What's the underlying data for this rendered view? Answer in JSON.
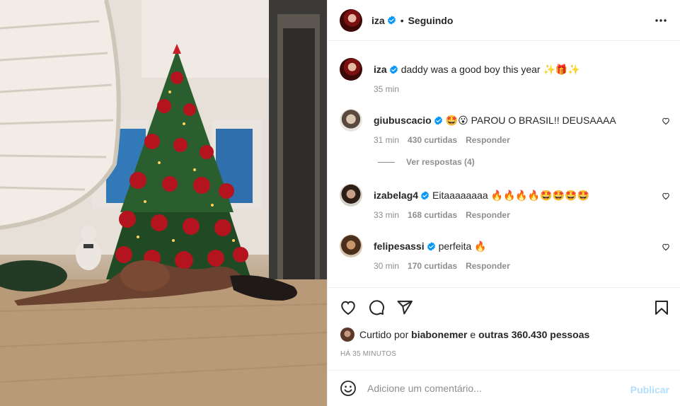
{
  "post": {
    "author": "iza",
    "follow_status": "Seguindo",
    "separator": "•",
    "caption": {
      "username": "iza",
      "text": "daddy was a good boy this year ✨🎁✨",
      "time": "35 min"
    },
    "comments": [
      {
        "username": "giubuscacio",
        "text": "🤩😮 PAROU O BRASIL!! DEUSAAAA",
        "time": "31 min",
        "likes": "430 curtidas",
        "reply_label": "Responder"
      },
      {
        "username": "izabelag4",
        "text": "Eitaaaaaaaa 🔥🔥🔥🔥🤩🤩🤩🤩",
        "time": "33 min",
        "likes": "168 curtidas",
        "reply_label": "Responder"
      },
      {
        "username": "felipesassi",
        "text": "perfeita 🔥",
        "time": "30 min",
        "likes": "170 curtidas",
        "reply_label": "Responder"
      }
    ],
    "view_replies": "Ver respostas (4)",
    "liked_by": {
      "prefix": "Curtido por",
      "user": "biabonemer",
      "connector": "e",
      "others": "outras 360.430 pessoas"
    },
    "time_ago": "HÁ 35 MINUTOS",
    "add_comment": {
      "placeholder": "Adicione um comentário...",
      "publish": "Publicar"
    }
  },
  "colors": {
    "verified": "#0095f6",
    "text": "#262626",
    "muted": "#8e8e8e",
    "publish_disabled": "#b2dffc"
  },
  "icons": [
    "more-icon",
    "verified-icon",
    "heart-icon",
    "comment-icon",
    "share-icon",
    "save-icon",
    "emoji-icon"
  ]
}
